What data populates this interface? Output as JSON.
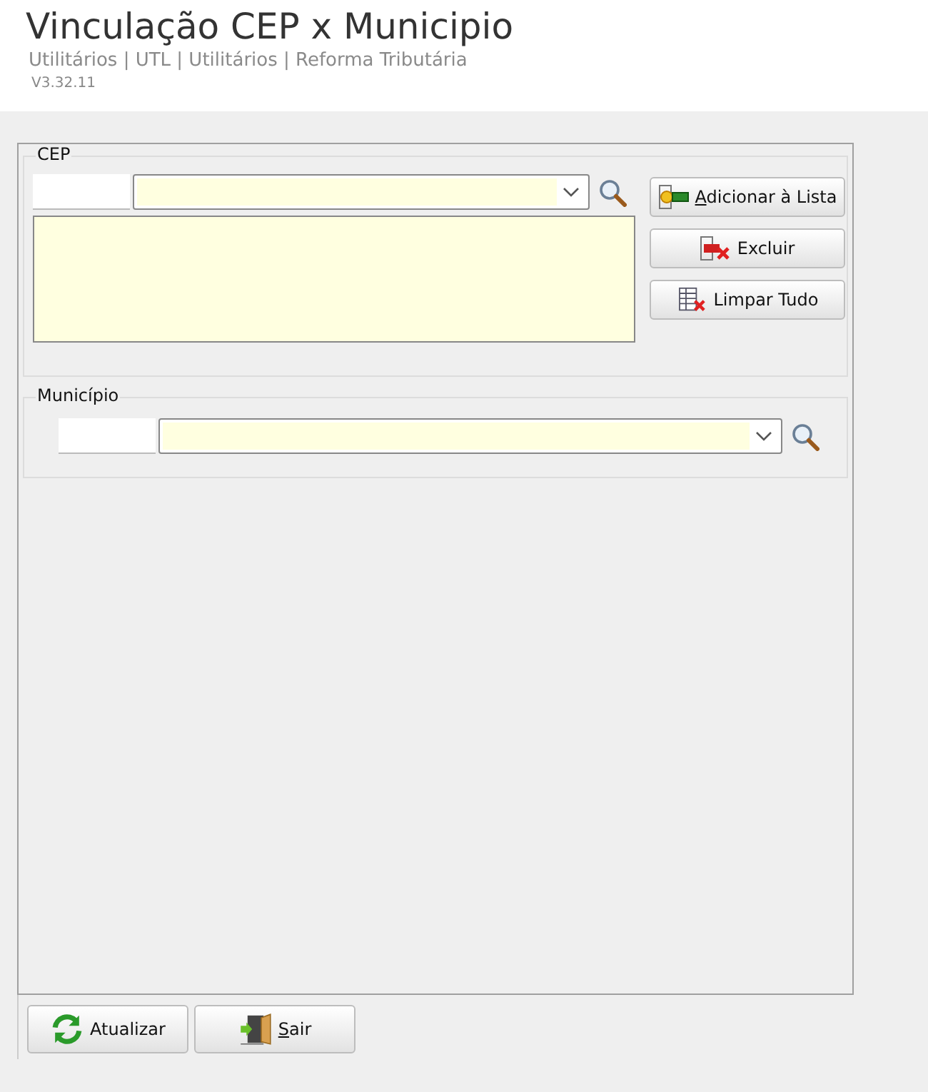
{
  "header": {
    "title": "Vinculação CEP x Municipio",
    "breadcrumb": "Utilitários | UTL | Utilitários | Reforma Tributária",
    "version": "V3.32.11"
  },
  "cep_group": {
    "label": "CEP",
    "buttons": [
      {
        "label": "Adicionar à Lista",
        "kind": "add",
        "mnemonic": true
      },
      {
        "label": "Excluir",
        "kind": "delete",
        "mnemonic": false
      },
      {
        "label": "Limpar Tudo",
        "kind": "clear",
        "mnemonic": false
      }
    ]
  },
  "municipio_group": {
    "label": "Município"
  },
  "footer_buttons": [
    {
      "label": "Atualizar",
      "kind": "refresh",
      "mnemonic": false
    },
    {
      "label": "Sair",
      "kind": "exit",
      "mnemonic": true
    }
  ]
}
